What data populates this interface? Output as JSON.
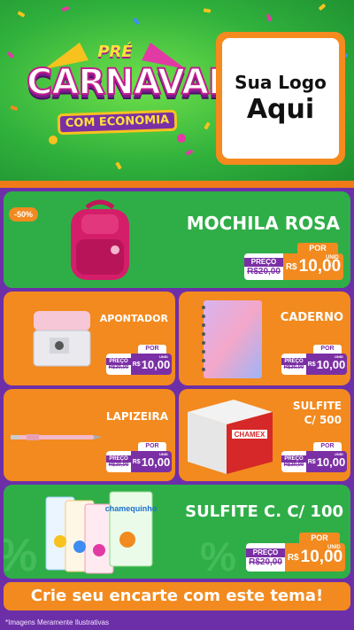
{
  "header": {
    "badge": {
      "line1": "PRÉ",
      "line2": "CARNAVAL",
      "line3": "COM ECONOMIA"
    },
    "logo_box": {
      "line1": "Sua Logo",
      "line2": "Aqui"
    }
  },
  "products": [
    {
      "id": "mochila",
      "title": "MOCHILA ROSA",
      "discount": "-50%",
      "por_label": "POR",
      "preco_label": "PREÇO",
      "old_price": "R$20,00",
      "currency": "R$",
      "new_price": "10,00",
      "unit": "UNID"
    },
    {
      "id": "apontador",
      "title": "APONTADOR",
      "por_label": "POR",
      "preco_label": "PREÇO",
      "old_price": "R$20,00",
      "currency": "R$",
      "new_price": "10,00",
      "unit": "UNID"
    },
    {
      "id": "caderno",
      "title": "CADERNO",
      "por_label": "POR",
      "preco_label": "PREÇO",
      "old_price": "R$20,00",
      "currency": "R$",
      "new_price": "10,00",
      "unit": "UNID"
    },
    {
      "id": "lapizeira",
      "title": "LAPIZEIRA",
      "por_label": "POR",
      "preco_label": "PREÇO",
      "old_price": "R$20,00",
      "currency": "R$",
      "new_price": "10,00",
      "unit": "UNID"
    },
    {
      "id": "sulfite500",
      "title_l1": "SULFITE",
      "title_l2": "C/ 500",
      "box_brand": "CHAMEX",
      "por_label": "POR",
      "preco_label": "PREÇO",
      "old_price": "R$20,00",
      "currency": "R$",
      "new_price": "10,00",
      "unit": "UNID"
    },
    {
      "id": "sulfitecc",
      "title": "SULFITE C. C/ 100",
      "pack_brand": "chamequinho",
      "por_label": "POR",
      "preco_label": "PREÇO",
      "old_price": "R$20,00",
      "currency": "R$",
      "new_price": "10,00",
      "unit": "UNID"
    }
  ],
  "footer": {
    "banner": "Crie seu encarte com este tema!",
    "disclaimer": "*Imagens Meramente Ilustrativas"
  },
  "colors": {
    "purple": "#6d2fa8",
    "green": "#2fae48",
    "orange": "#f28a1f",
    "badge_purple": "#7b2fa5"
  }
}
